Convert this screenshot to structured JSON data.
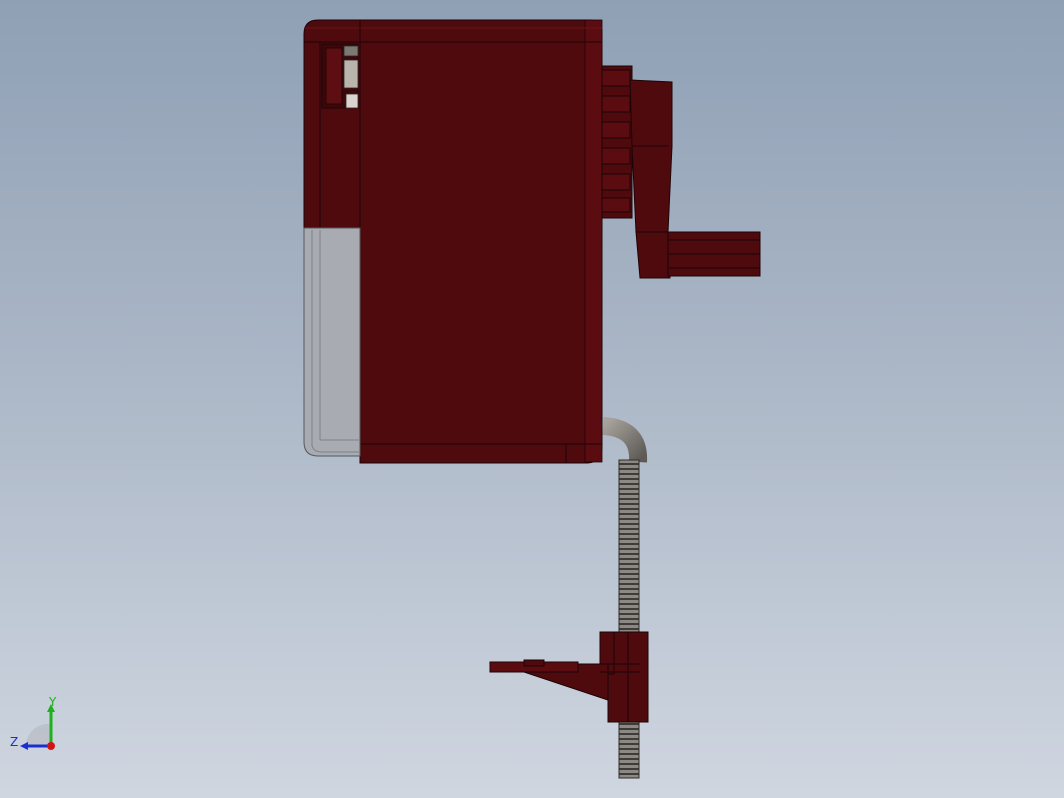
{
  "viewport": {
    "background_top": "#8fa0b5",
    "background_bottom": "#cfd6e0"
  },
  "model": {
    "body_color": "#4e0a0d",
    "edge_color": "#1f0406",
    "window_color": "#a8acb2",
    "threaded_rod_color": "#6d6a66"
  },
  "triad": {
    "x_color": "#d21414",
    "y_color": "#1fb01f",
    "z_color": "#1a2fd0",
    "y_label": "Y",
    "z_label": "Z"
  }
}
